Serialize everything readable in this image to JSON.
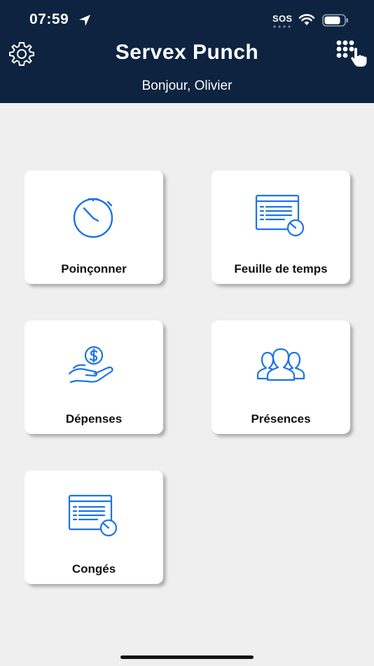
{
  "status_bar": {
    "time": "07:59",
    "sos": "SOS"
  },
  "header": {
    "title": "Servex Punch",
    "greeting": "Bonjour, Olivier",
    "settings_icon": "gear-icon",
    "keypad_icon": "keypad-touch-icon"
  },
  "tiles": [
    {
      "label": "Poinçonner",
      "icon": "stopwatch-icon"
    },
    {
      "label": "Feuille de temps",
      "icon": "timesheet-icon"
    },
    {
      "label": "Dépenses",
      "icon": "money-hand-icon"
    },
    {
      "label": "Présences",
      "icon": "people-group-icon"
    },
    {
      "label": "Congés",
      "icon": "calendar-clock-icon"
    }
  ],
  "colors": {
    "header_bg": "#0d2340",
    "accent": "#1a73e8",
    "background": "#efefef"
  }
}
